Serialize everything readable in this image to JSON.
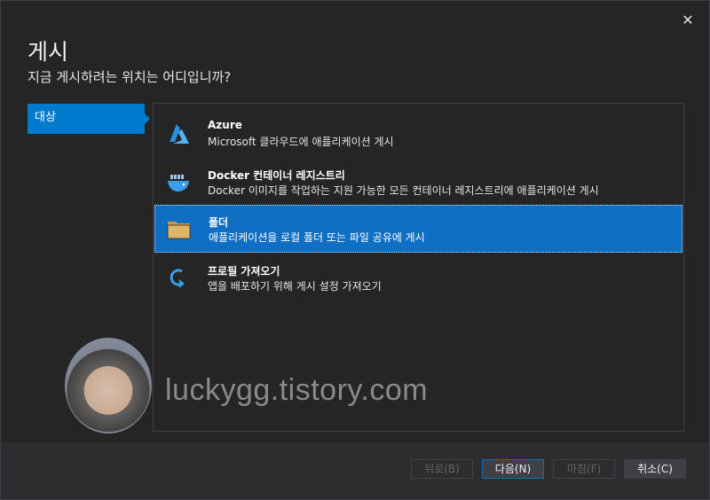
{
  "dialog": {
    "close_glyph": "✕",
    "title": "게시",
    "subtitle": "지금 게시하려는 위치는 어디입니까?"
  },
  "sidebar": {
    "items": [
      {
        "label": "대상",
        "selected": true
      }
    ]
  },
  "options": [
    {
      "title": "Azure",
      "description": "Microsoft 클라우드에 애플리케이션 게시",
      "icon": "azure-icon",
      "selected": false
    },
    {
      "title": "Docker 컨테이너 레지스트리",
      "description": "Docker 이미지를 작업하는 지원 가능한 모든 컨테이너 레지스트리에 애플리케이션 게시",
      "icon": "docker-icon",
      "selected": false
    },
    {
      "title": "폴더",
      "description": "애플리케이션을 로컬 폴더 또는 파일 공유에 게시",
      "icon": "folder-icon",
      "selected": true
    },
    {
      "title": "프로필 가져오기",
      "description": "앱을 배포하기 위해 게시 설정 가져오기",
      "icon": "import-profile-icon",
      "selected": false
    }
  ],
  "watermark": "luckygg.tistory.com",
  "footer": {
    "back_label": "뒤로(B)",
    "next_label": "다음(N)",
    "finish_label": "마침(F)",
    "cancel_label": "취소(C)"
  },
  "colors": {
    "accent": "#007acc",
    "selected_option": "#0e6fc5",
    "background": "#252526"
  }
}
